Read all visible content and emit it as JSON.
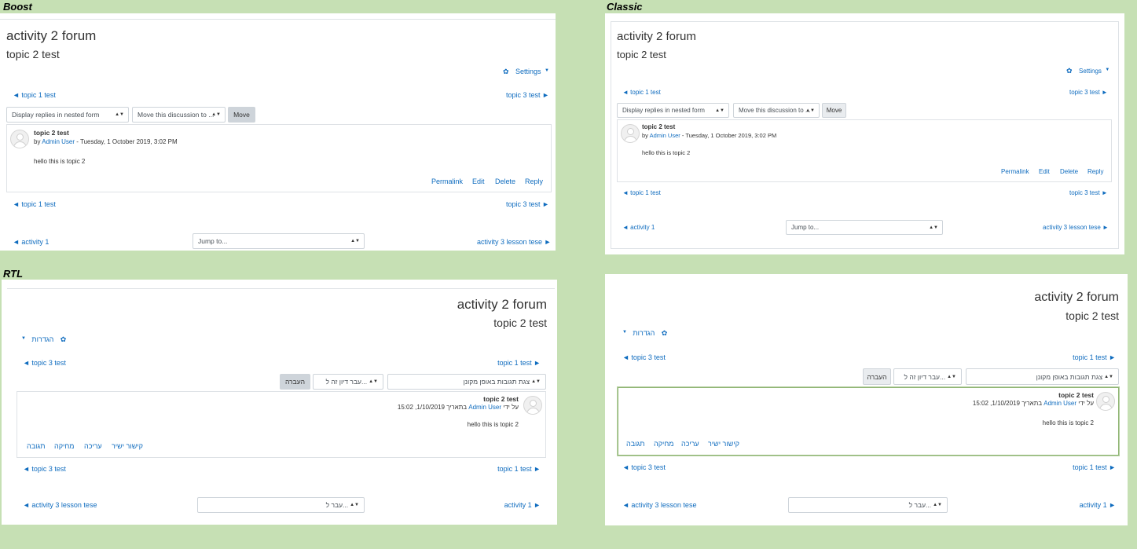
{
  "boost": {
    "caption": "Boost",
    "title": "activity 2 forum",
    "subtitle": "topic 2 test",
    "settings": "Settings",
    "prev_topic": "◄ topic 1 test",
    "next_topic": "topic 3 test ►",
    "display_mode": "Display replies in nested form",
    "move_select": "Move this discussion to ...",
    "move_button": "Move",
    "post": {
      "title": "topic 2 test",
      "by": "by",
      "author": "Admin User",
      "date": "- Tuesday, 1 October 2019, 3:02 PM",
      "body": "hello this is topic 2",
      "permalink": "Permalink",
      "edit": "Edit",
      "delete": "Delete",
      "reply": "Reply"
    },
    "prev_activity": "◄ activity 1",
    "jump_to": "Jump to...",
    "next_activity": "activity 3 lesson tese ►"
  },
  "classic": {
    "caption": "Classic",
    "title": "activity 2 forum",
    "subtitle": "topic 2 test",
    "settings": "Settings",
    "prev_topic": "◄ topic 1 test",
    "next_topic": "topic 3 test ►",
    "display_mode": "Display replies in nested form",
    "move_select": "Move this discussion to ...",
    "move_button": "Move",
    "post": {
      "title": "topic 2 test",
      "by": "by",
      "author": "Admin User",
      "date": "- Tuesday, 1 October 2019, 3:02 PM",
      "body": "hello this is topic 2",
      "permalink": "Permalink",
      "edit": "Edit",
      "delete": "Delete",
      "reply": "Reply"
    },
    "prev_activity": "◄ activity 1",
    "jump_to": "Jump to...",
    "next_activity": "activity 3 lesson tese ►"
  },
  "rtl": {
    "caption": "RTL",
    "title": "activity 2 forum",
    "subtitle": "topic 2 test",
    "settings": "הגדרות",
    "left_topic": "◄ topic 3 test",
    "right_topic": "topic 1 test ►",
    "display_mode": "צגת תגובות באופן מקונן",
    "move_select": "עבר דיון זה ל...",
    "move_button": "העברה",
    "post": {
      "title": "topic 2 test",
      "by": "על ידי",
      "author": "Admin User",
      "date": "בתאריך 1/10/2019, 15:02",
      "body": "hello this is topic 2",
      "permalink": "קישור ישיר",
      "edit": "עריכה",
      "delete": "מחיקה",
      "reply": "תגובה"
    },
    "left_activity": "◄ activity 3 lesson tese",
    "jump_to": "עבר ל...",
    "right_activity": "activity 1 ►"
  },
  "rtl_classic": {
    "title": "activity 2 forum",
    "subtitle": "topic 2 test",
    "settings": "הגדרות",
    "left_topic": "◄ topic 3 test",
    "right_topic": "topic 1 test ►",
    "display_mode": "צגת תגובות באופן מקונן",
    "move_select": "עבר דיון זה ל...",
    "move_button": "העברה",
    "post": {
      "title": "topic 2 test",
      "by": "על ידי",
      "author": "Admin User",
      "date": "בתאריך 1/10/2019, 15:02",
      "body": "hello this is topic 2",
      "permalink": "קישור ישיר",
      "edit": "עריכה",
      "delete": "מחיקה",
      "reply": "תגובה"
    },
    "left_activity": "◄ activity 3 lesson tese",
    "jump_to": "עבר ל...",
    "right_activity": "activity 1 ►"
  },
  "colors": {
    "background": "#c6e0b4",
    "link": "#0f6cbf",
    "border": "#dee2e6",
    "button": "#ced4da"
  }
}
